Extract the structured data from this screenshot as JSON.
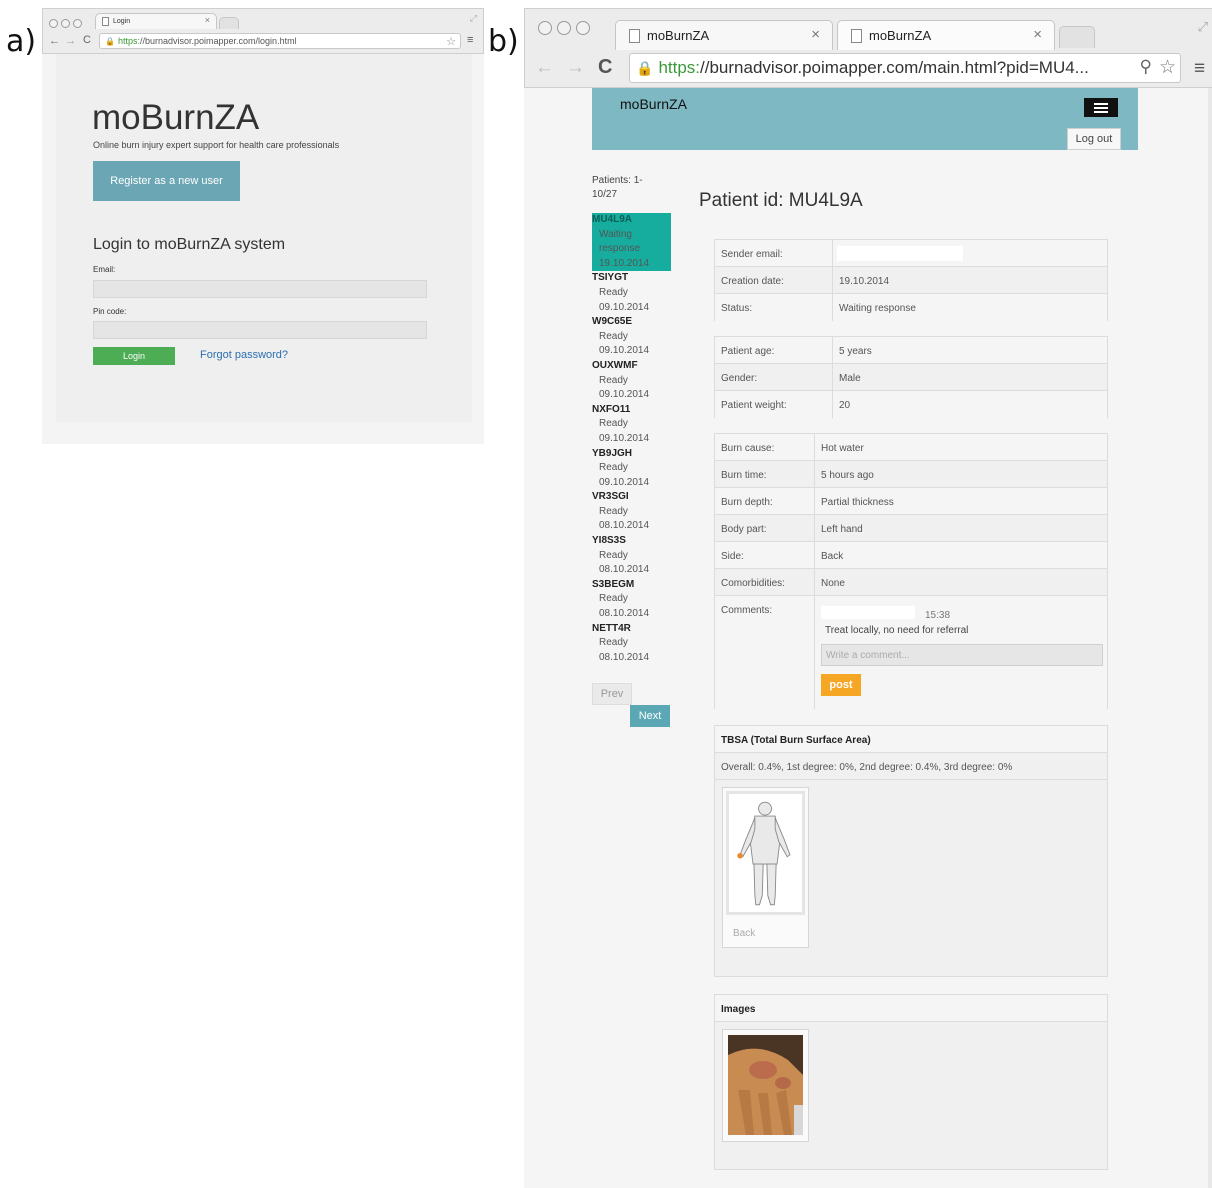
{
  "labels": {
    "a": "a)",
    "b": "b)"
  },
  "left": {
    "tab_title": "Login",
    "url_https": "https:",
    "url_rest": "//burnadvisor.poimapper.com/login.html",
    "app_title": "moBurnZA",
    "tagline": "Online burn injury expert support for health care professionals",
    "register_label": "Register as a new user",
    "login_heading": "Login to moBurnZA system",
    "email_label": "Email:",
    "pin_label": "Pin code:",
    "login_label": "Login",
    "forgot_label": "Forgot password?"
  },
  "right": {
    "tab1_title": "moBurnZA",
    "tab2_title": "moBurnZA",
    "url_https": "https:",
    "url_rest": "//burnadvisor.poimapper.com/main.html?pid=MU4...",
    "app_title": "moBurnZA",
    "logout_label": "Log out",
    "patients_count": "Patients: 1-\n10/27",
    "patients": [
      {
        "id": "MU4L9A",
        "status": "Waiting",
        "status2": "response",
        "date": "19.10.2014",
        "selected": true
      },
      {
        "id": "TSIYGT",
        "status": "Ready",
        "date": "09.10.2014"
      },
      {
        "id": "W9C65E",
        "status": "Ready",
        "date": "09.10.2014"
      },
      {
        "id": "OUXWMF",
        "status": "Ready",
        "date": "09.10.2014"
      },
      {
        "id": "NXFO11",
        "status": "Ready",
        "date": "09.10.2014"
      },
      {
        "id": "YB9JGH",
        "status": "Ready",
        "date": "09.10.2014"
      },
      {
        "id": "VR3SGI",
        "status": "Ready",
        "date": "08.10.2014"
      },
      {
        "id": "YI8S3S",
        "status": "Ready",
        "date": "08.10.2014"
      },
      {
        "id": "S3BEGM",
        "status": "Ready",
        "date": "08.10.2014"
      },
      {
        "id": "NETT4R",
        "status": "Ready",
        "date": "08.10.2014"
      }
    ],
    "prev_label": "Prev",
    "next_label": "Next",
    "patient_title": "Patient id: MU4L9A",
    "info": {
      "sender_email_key": "Sender email:",
      "creation_key": "Creation date:",
      "creation_val": "19.10.2014",
      "status_key": "Status:",
      "status_val": "Waiting response"
    },
    "patient": {
      "age_key": "Patient age:",
      "age_val": "5 years",
      "gender_key": "Gender:",
      "gender_val": "Male",
      "weight_key": "Patient weight:",
      "weight_val": "20"
    },
    "burn": {
      "cause_key": "Burn cause:",
      "cause_val": "Hot water",
      "time_key": "Burn time:",
      "time_val": "5 hours ago",
      "depth_key": "Burn depth:",
      "depth_val": "Partial thickness",
      "part_key": "Body part:",
      "part_val": "Left hand",
      "side_key": "Side:",
      "side_val": "Back",
      "comorb_key": "Comorbidities:",
      "comorb_val": "None",
      "comments_key": "Comments:",
      "comment_time": "15:38",
      "comment_text": "Treat locally, no need for referral",
      "comment_placeholder": "Write a comment...",
      "post_label": "post"
    },
    "tbsa": {
      "heading": "TBSA (Total Burn Surface Area)",
      "summary": "Overall: 0.4%, 1st degree: 0%, 2nd degree: 0.4%, 3rd degree: 0%",
      "thumb_caption": "Back"
    },
    "images": {
      "heading": "Images"
    }
  },
  "colors": {
    "accent": "#7eb8c3",
    "selected": "#16ad9e",
    "login": "#4cad55",
    "post": "#f5a623",
    "https": "#3a9a37"
  }
}
